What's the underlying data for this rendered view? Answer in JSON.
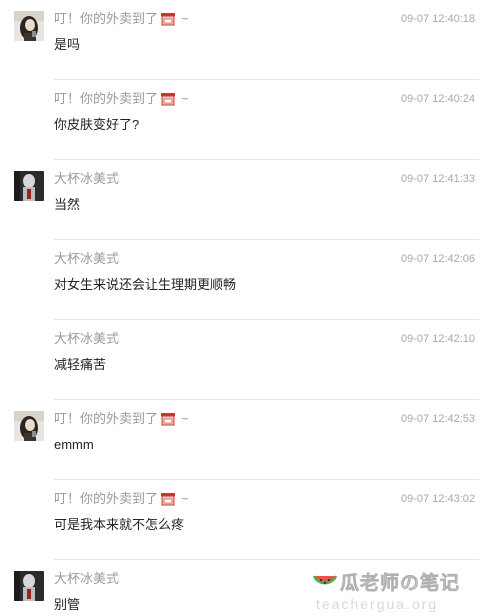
{
  "messages": [
    {
      "author": "叮！你的外卖到了",
      "has_cup_icon": true,
      "tilde": "~",
      "time": "09-07 12:40:18",
      "text": "是吗",
      "avatar": "girl-photo"
    },
    {
      "author": "叮！你的外卖到了",
      "has_cup_icon": true,
      "tilde": "~",
      "time": "09-07 12:40:24",
      "text": "你皮肤变好了?",
      "avatar": "none"
    },
    {
      "author": "大杯冰美式",
      "has_cup_icon": false,
      "tilde": "",
      "time": "09-07 12:41:33",
      "text": "当然",
      "avatar": "dark-figure"
    },
    {
      "author": "大杯冰美式",
      "has_cup_icon": false,
      "tilde": "",
      "time": "09-07 12:42:06",
      "text": "对女生来说还会让生理期更顺畅",
      "avatar": "none"
    },
    {
      "author": "大杯冰美式",
      "has_cup_icon": false,
      "tilde": "",
      "time": "09-07 12:42:10",
      "text": "减轻痛苦",
      "avatar": "none"
    },
    {
      "author": "叮！你的外卖到了",
      "has_cup_icon": true,
      "tilde": "~",
      "time": "09-07 12:42:53",
      "text": "emmm",
      "avatar": "girl-photo"
    },
    {
      "author": "叮！你的外卖到了",
      "has_cup_icon": true,
      "tilde": "~",
      "time": "09-07 12:43:02",
      "text": "可是我本来就不怎么疼",
      "avatar": "none"
    },
    {
      "author": "大杯冰美式",
      "has_cup_icon": false,
      "tilde": "",
      "time": "",
      "text": "别管",
      "avatar": "dark-figure"
    }
  ],
  "watermark": {
    "main": "瓜老师の笔记",
    "sub": "teachergua.org",
    "icon": "watermelon-icon"
  },
  "colors": {
    "author": "#9a9a9a",
    "time": "#a8a8a8",
    "text": "#222222",
    "divider": "#e6e6e6",
    "cup_red": "#c0392b",
    "cup_pink": "#f6c6c6"
  }
}
